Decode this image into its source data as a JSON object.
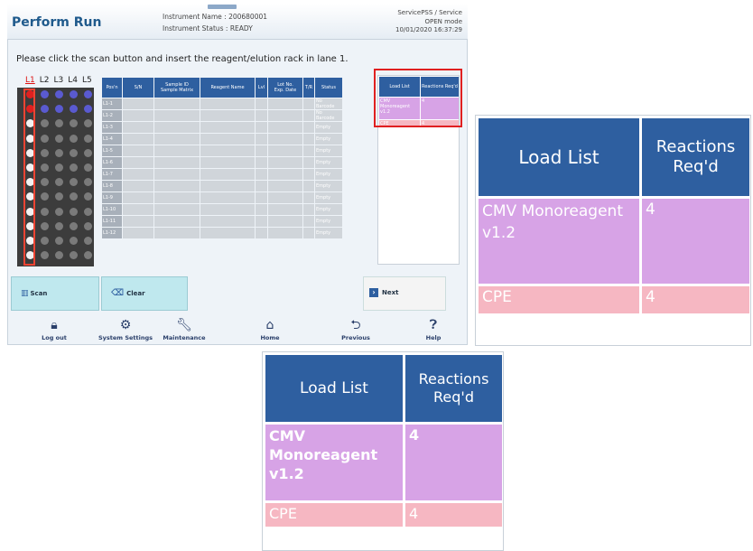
{
  "header": {
    "title": "Perform Run",
    "instrument_name": "Instrument Name : 200680001",
    "instrument_status": "Instrument Status : READY",
    "user": "ServicePSS / Service",
    "mode": "OPEN mode",
    "datetime": "10/01/2020 16:37:29"
  },
  "instruction": "Please click the scan button and insert the reagent/elution rack in lane 1.",
  "lanes": [
    "L1",
    "L2",
    "L3",
    "L4",
    "L5"
  ],
  "grid": {
    "columns": [
      "Pos'n",
      "S/N",
      "Sample ID\nSample Matrix",
      "Reagent Name",
      "Lvl",
      "Lot No.\nExp. Date",
      "T/R",
      "Status"
    ],
    "rows": [
      {
        "pos": "L1-1",
        "status": "No Barcode"
      },
      {
        "pos": "L1-2",
        "status": "No Barcode"
      },
      {
        "pos": "L1-3",
        "status": "Empty"
      },
      {
        "pos": "L1-4",
        "status": "Empty"
      },
      {
        "pos": "L1-5",
        "status": "Empty"
      },
      {
        "pos": "L1-6",
        "status": "Empty"
      },
      {
        "pos": "L1-7",
        "status": "Empty"
      },
      {
        "pos": "L1-8",
        "status": "Empty"
      },
      {
        "pos": "L1-9",
        "status": "Empty"
      },
      {
        "pos": "L1-10",
        "status": "Empty"
      },
      {
        "pos": "L1-11",
        "status": "Empty"
      },
      {
        "pos": "L1-12",
        "status": "Empty"
      }
    ]
  },
  "load_list": {
    "header_name": "Load List",
    "header_reactions": "Reactions Req'd",
    "items": [
      {
        "name": "CMV Monoreagent v1.2",
        "reactions": "4",
        "color": "#d7a3e6"
      },
      {
        "name": "CPE",
        "reactions": "4",
        "color": "#f6b7c2"
      }
    ]
  },
  "buttons": {
    "scan": "Scan",
    "clear": "Clear",
    "next": "Next"
  },
  "nav": [
    {
      "label": "Log out",
      "icon": "lock-icon"
    },
    {
      "label": "System Settings",
      "icon": "gear-icon"
    },
    {
      "label": "Maintenance",
      "icon": "wrench-icon"
    },
    {
      "label": "Home",
      "icon": "home-icon"
    },
    {
      "label": "Previous",
      "icon": "previous-icon"
    },
    {
      "label": "Help",
      "icon": "help-icon"
    }
  ],
  "colors": {
    "header_blue": "#2e5fa0",
    "purple_row": "#d7a3e6",
    "pink_row": "#f6b7c2",
    "highlight_red": "#e02020",
    "button_cyan": "#bfe8ee"
  }
}
